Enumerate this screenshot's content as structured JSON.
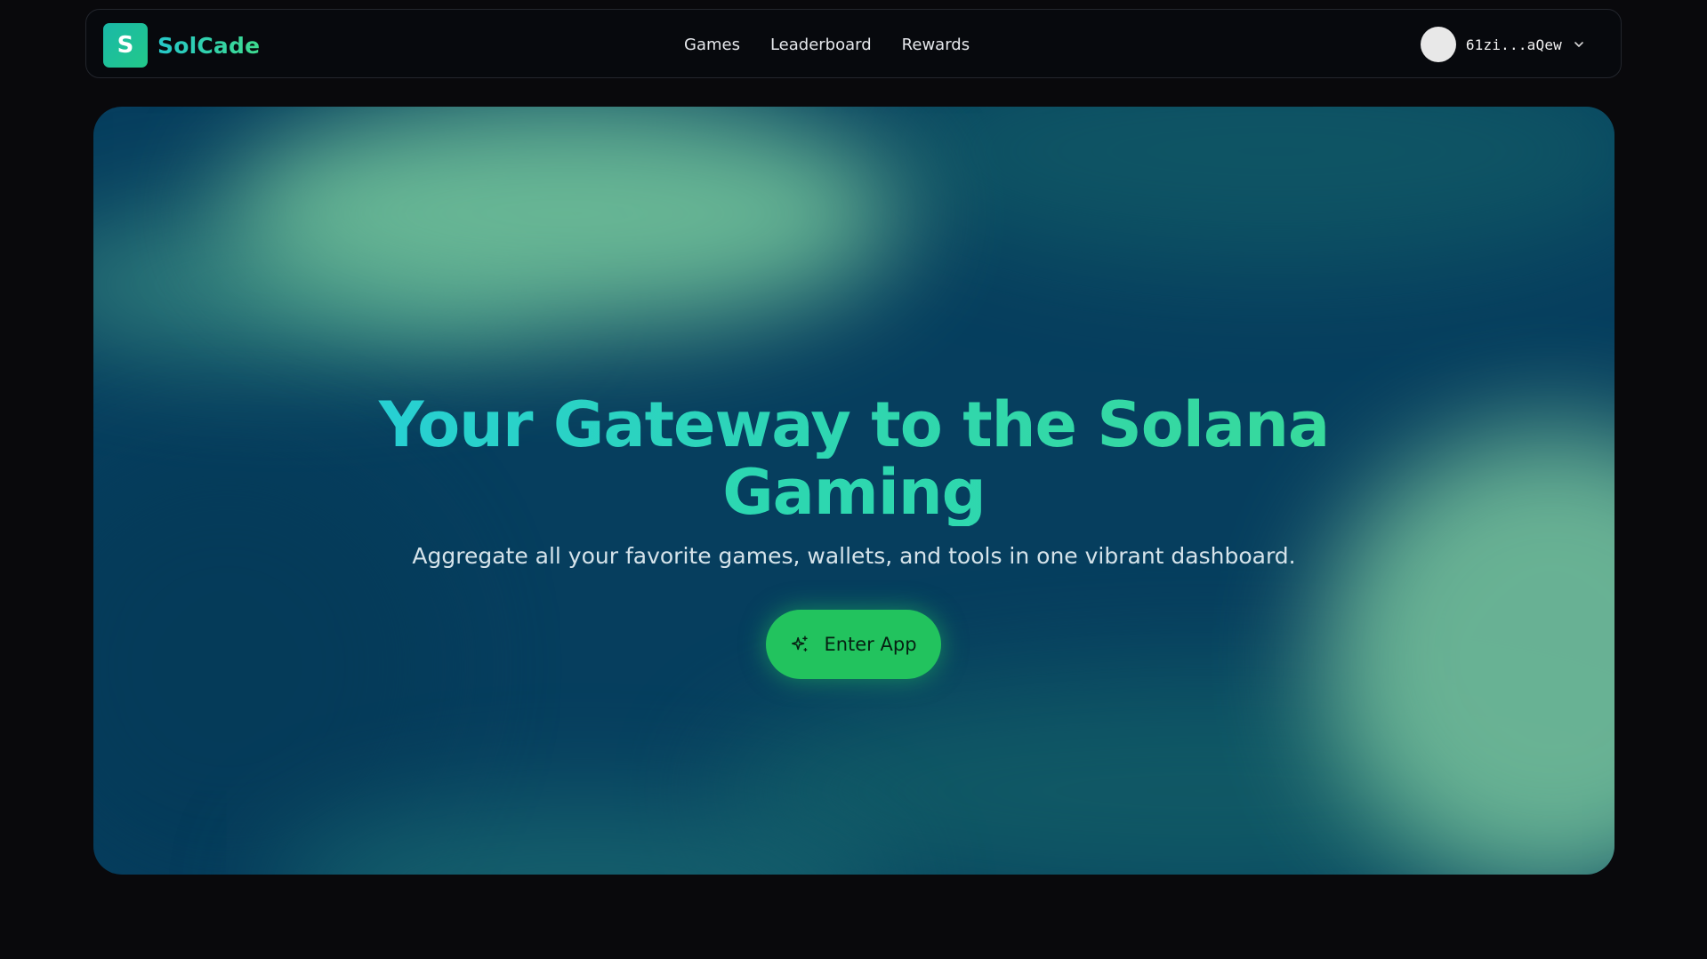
{
  "navbar": {
    "logo_letter": "S",
    "brand": "SolCade",
    "links": [
      {
        "label": "Games"
      },
      {
        "label": "Leaderboard"
      },
      {
        "label": "Rewards"
      }
    ],
    "wallet": {
      "address": "61zi...aQew",
      "chevron_icon": "chevron-down-icon"
    }
  },
  "hero": {
    "title_line_1": "Your Gateway to the Solana",
    "title_line_2": "Gaming",
    "subtitle": "Aggregate all your favorite games, wallets, and tools in one vibrant dashboard.",
    "cta": {
      "label": "Enter App",
      "icon": "sparkle-icon"
    }
  },
  "colors": {
    "page_bg": "#09090c",
    "accent_green": "#22c35e",
    "brand_gradient_start": "#25c7c9",
    "brand_gradient_end": "#3edb8f",
    "hero_base": "#063e5e"
  }
}
